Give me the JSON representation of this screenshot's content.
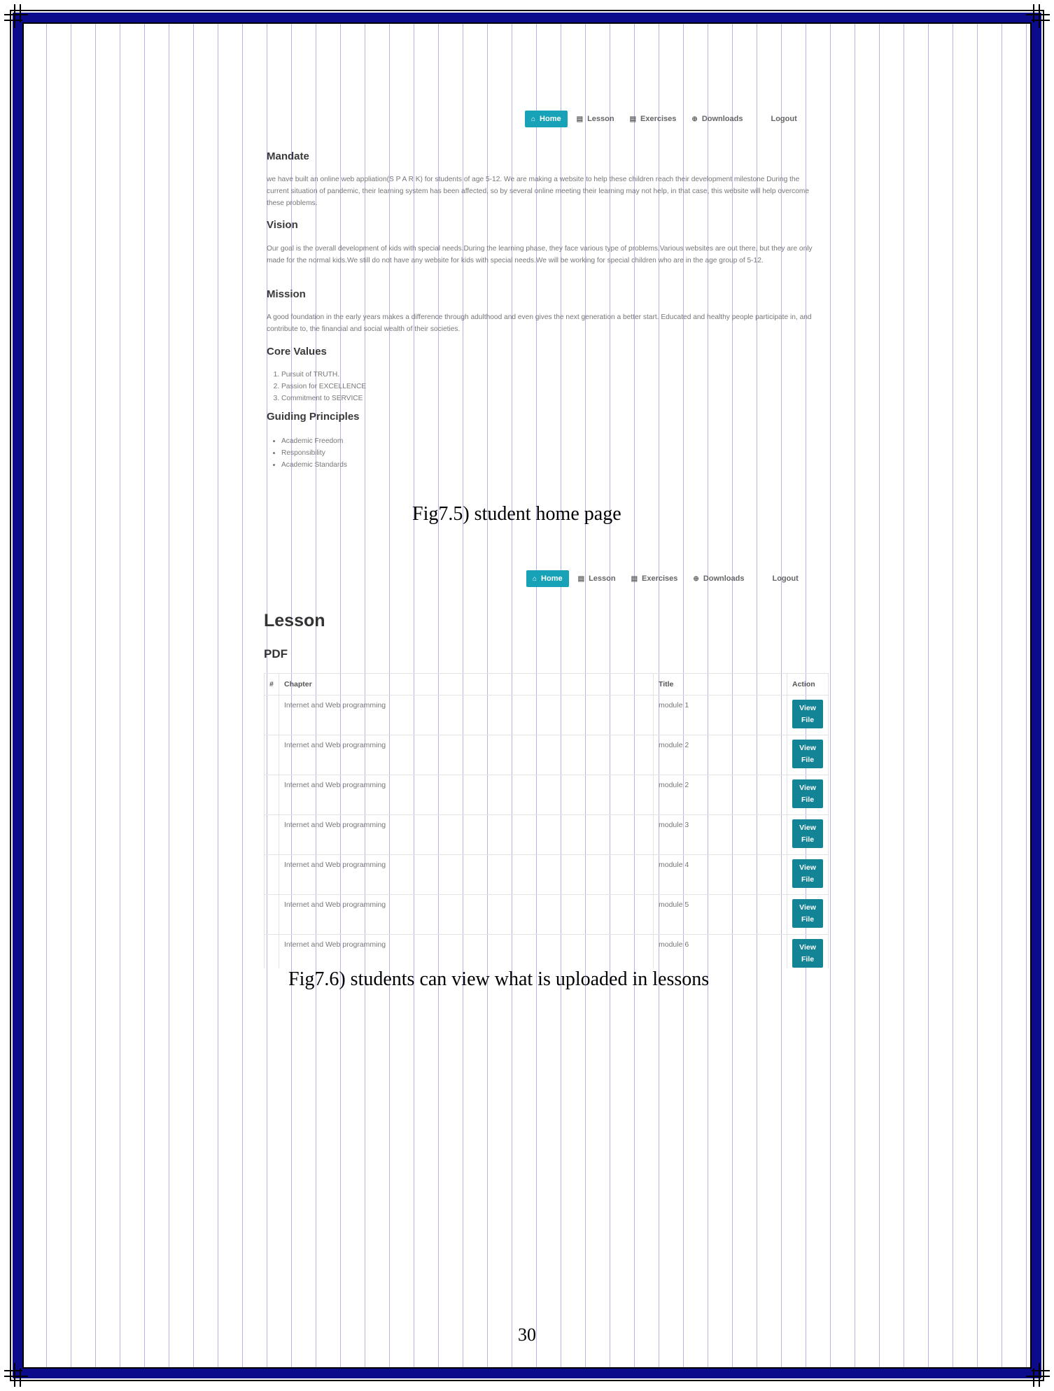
{
  "nav": {
    "home": "Home",
    "lesson": "Lesson",
    "exercises": "Exercises",
    "downloads": "Downloads",
    "logout": "Logout"
  },
  "home": {
    "mandate_heading": "Mandate",
    "mandate_text": "we have built an online web appliation(S P A R K) for students of age 5-12. We are making a website to help these children reach their development milestone During the current situation of pandemic, their learning system has been affected, so by several online meeting their learning may not help, in that case, this website will help overcome these problems.",
    "vision_heading": "Vision",
    "vision_text": "Our goal is the overall development of kids with special needs.During the learning phase, they face various type of problems.Various websites are out there, but they are only made for the normal kids.We still do not have any website for kids with special needs.We will be working for special children who are in the age group of 5-12.",
    "mission_heading": "Mission",
    "mission_text": "A good foundation in the early years makes a difference through adulthood and even gives the next generation a better start. Educated and healthy people participate in, and contribute to, the financial and social wealth of their societies.",
    "core_values_heading": "Core Values",
    "core_values": [
      "Pursuit of TRUTH.",
      "Passion for EXCELLENCE",
      "Commitment to SERVICE"
    ],
    "guiding_heading": "Guiding Principles",
    "guiding": [
      "Academic Freedom",
      "Responsibility",
      "Academic Standards"
    ]
  },
  "caption1": "Fig7.5) student home page",
  "lesson": {
    "title": "Lesson",
    "subtitle": "PDF",
    "headers": [
      "#",
      "Chapter",
      "Title",
      "Action"
    ],
    "rows": [
      {
        "chapter": "Internet and Web programming",
        "title": "module 1",
        "action": "View File"
      },
      {
        "chapter": "Internet and Web programming",
        "title": "module 2",
        "action": "View File"
      },
      {
        "chapter": "Internet and Web programming",
        "title": "module 2",
        "action": "View File"
      },
      {
        "chapter": "Internet and Web programming",
        "title": "module 3",
        "action": "View File"
      },
      {
        "chapter": "Internet and Web programming",
        "title": "module 4",
        "action": "View File"
      },
      {
        "chapter": "Internet and Web programming",
        "title": "module 5",
        "action": "View File"
      },
      {
        "chapter": "Internet and Web programming",
        "title": "module 6",
        "action": "View File"
      }
    ]
  },
  "caption2": "Fig7.6) students can view what is uploaded in  lessons",
  "page_number": "30",
  "colors": {
    "border_blue": "#0b0b8c",
    "active_nav": "#17a2b8",
    "button": "#138496"
  }
}
